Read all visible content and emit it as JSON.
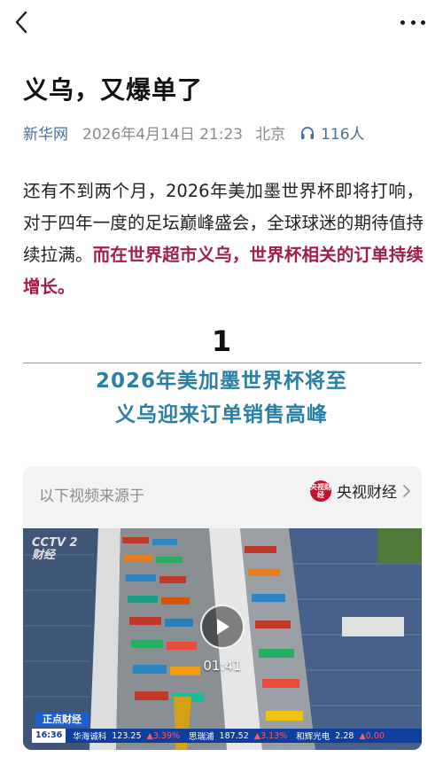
{
  "header": {
    "back_icon": "chevron-left-icon",
    "more_icon": "more-dots-icon"
  },
  "article": {
    "title": "义乌，又爆单了",
    "source": "新华网",
    "date": "2026年4月14日 21:23",
    "location": "北京",
    "listeners": "116人",
    "listen_icon": "headphones-icon",
    "paragraph_plain": "还有不到两个月，2026年美加墨世界杯即将打响，对于四年一度的足坛巅峰盛会，全球球迷的期待值持续拉满。",
    "paragraph_highlight": "而在世界超市义乌，世界杯相关的订单持续增长。",
    "highlight_color": "#a11d4a"
  },
  "section": {
    "number": "1",
    "title_line1": "2026年美加墨世界杯将至",
    "title_line2": "义乌迎来订单销售高峰",
    "title_color": "#2b7fa3"
  },
  "video_card": {
    "source_label": "以下视频来源于",
    "brand_logo_text": "央视财经",
    "brand_name": "央视财经",
    "chevron_icon": "chevron-right-icon",
    "channel_logo": "CCTV 2",
    "channel_sub": "财经",
    "play_icon": "play-icon",
    "duration": "01:41",
    "ticker_label": "正点财经",
    "ticker_time": "16:36",
    "stocks": [
      {
        "name": "华海诚科",
        "value": "123.25",
        "change": "▲3.39%"
      },
      {
        "name": "思瑞浦",
        "value": "187.52",
        "change": "▲3.13%"
      },
      {
        "name": "和辉光电",
        "value": "2.28",
        "change": "▲0.00"
      }
    ]
  }
}
